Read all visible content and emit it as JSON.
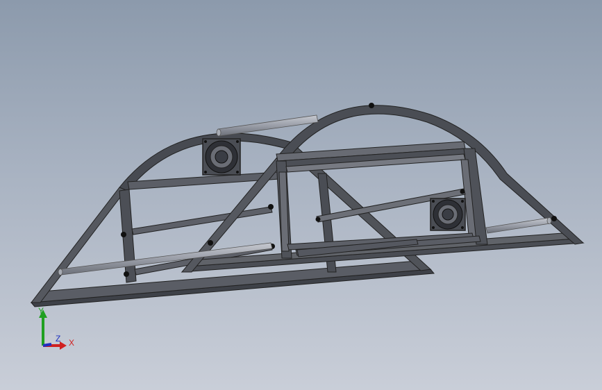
{
  "triad": {
    "x_label": "X",
    "y_label": "Y",
    "z_label": "Z"
  },
  "colors": {
    "background_top": "#8c9aac",
    "background_bottom": "#c9ced8",
    "frame_dark": "#3a3d44",
    "frame_mid": "#55585f",
    "frame_light": "#7d8089",
    "rod": "#9a9ea8",
    "x_axis": "#d02020",
    "y_axis": "#20a020",
    "z_axis": "#2030c0"
  },
  "model": {
    "components": [
      "frame-arch-rear",
      "frame-arch-front",
      "rod",
      "fan-left",
      "fan-right"
    ]
  }
}
